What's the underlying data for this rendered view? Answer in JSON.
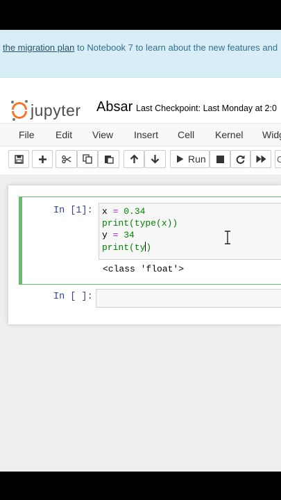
{
  "banner": {
    "link_text": "the migration plan",
    "rest_text": " to Notebook 7 to learn about the new features and"
  },
  "header": {
    "logo_text": "jupyter",
    "notebook_name": "Absar",
    "checkpoint": "Last Checkpoint: Last Monday at 2:0"
  },
  "menu": [
    "File",
    "Edit",
    "View",
    "Insert",
    "Cell",
    "Kernel",
    "Widg"
  ],
  "toolbar": {
    "run_label": "Run",
    "icons": [
      "save-icon",
      "plus-icon",
      "cut-icon",
      "copy-icon",
      "paste-icon",
      "arrow-up-icon",
      "arrow-down-icon",
      "run-icon",
      "stop-icon",
      "restart-icon",
      "fast-forward-icon"
    ]
  },
  "cells": [
    {
      "prompt": "In [1]:",
      "lines": [
        {
          "a": "x ",
          "b": "=",
          "c": " ",
          "d": "0.34",
          "e": ""
        },
        {
          "a": "",
          "b": "",
          "c": "print(type(x))",
          "d": "",
          "e": ""
        },
        {
          "a": "y ",
          "b": "=",
          "c": " ",
          "d": "34",
          "e": ""
        },
        {
          "a": "",
          "b": "",
          "c": "print(ty",
          "d": "",
          "e": ")"
        }
      ],
      "output": "<class 'float'>"
    },
    {
      "prompt": "In [ ]:"
    }
  ],
  "colors": {
    "accent_green": "#66bb6a",
    "prompt_blue": "#303f9f",
    "banner_bg": "#d9edf7",
    "jupyter_orange": "#f37726"
  }
}
